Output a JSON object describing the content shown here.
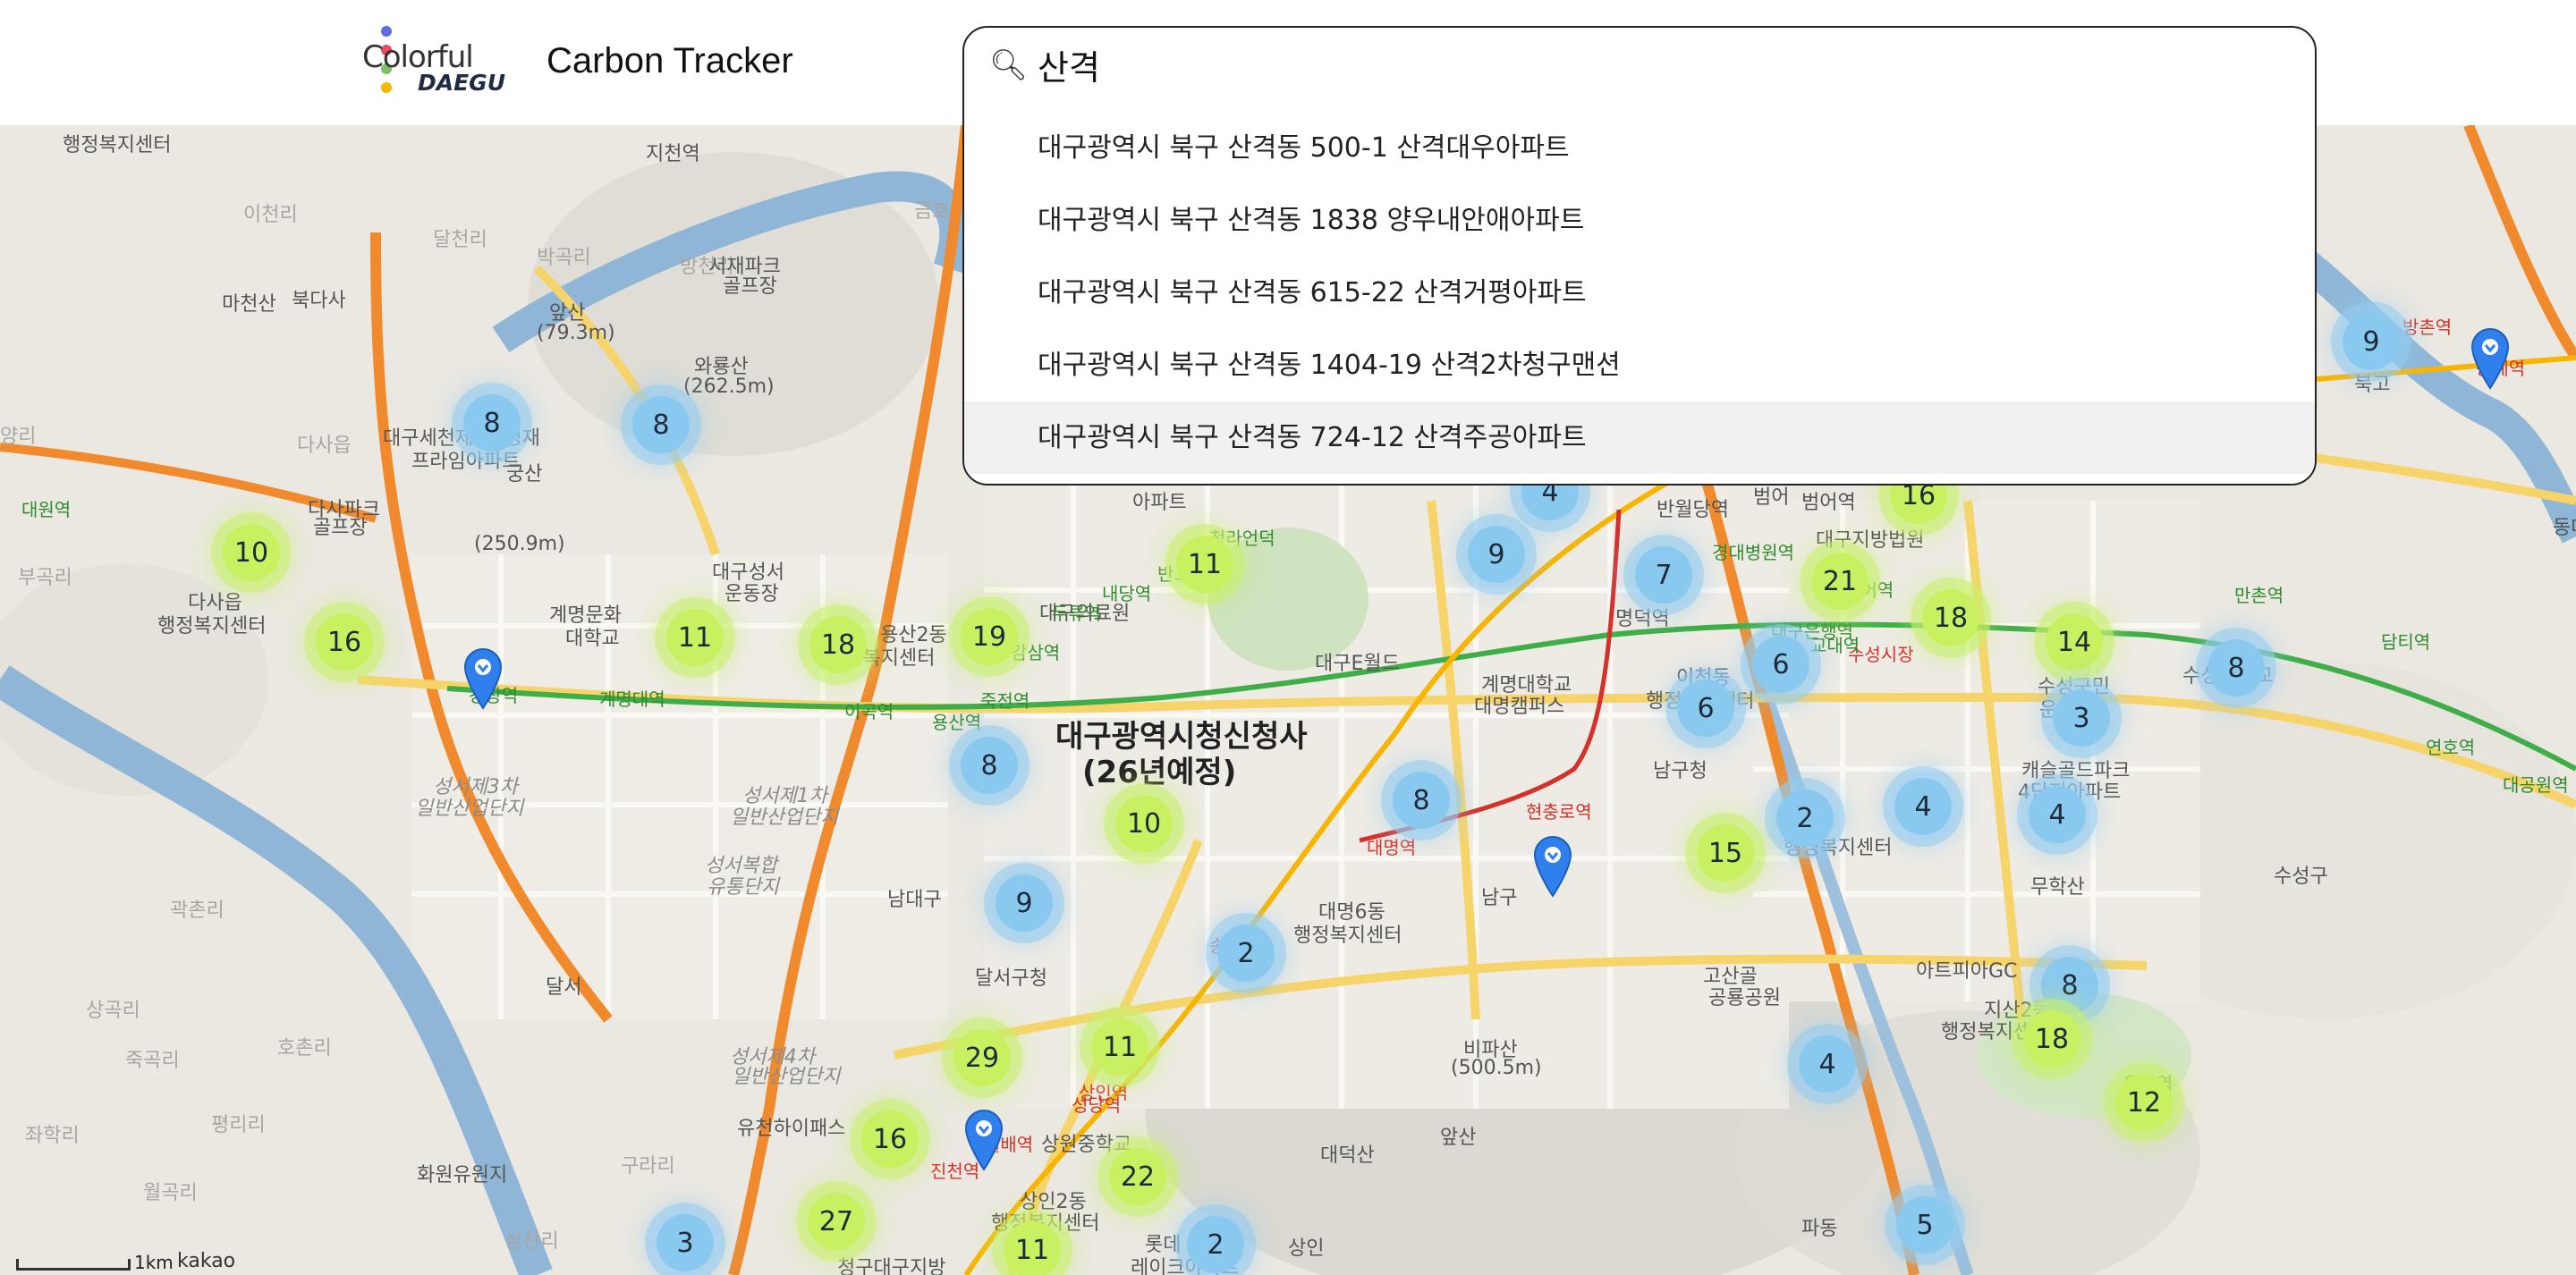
{
  "header": {
    "logo_line1": "Colorful",
    "logo_line2": "DAEGU",
    "title": "Carbon Tracker"
  },
  "search": {
    "query": "산격",
    "suggestions": [
      "대구광역시 북구 산격동 500-1 산격대우아파트",
      "대구광역시 북구 산격동 1838 양우내안애아파트",
      "대구광역시 북구 산격동 615-22 산격거평아파트",
      "대구광역시 북구 산격동 1404-19 산격2차청구맨션",
      "대구광역시 북구 산격동 724-12 산격주공아파트"
    ],
    "highlighted_index": 4
  },
  "map": {
    "attribution": "kakao",
    "scale_label": "1km",
    "labels": [
      {
        "text": "행정복지센터"
      },
      {
        "text": "지천역"
      },
      {
        "text": "금호"
      },
      {
        "text": "이천리"
      },
      {
        "text": "달천리"
      },
      {
        "text": "박곡리"
      },
      {
        "text": "방천리"
      },
      {
        "text": "마천산"
      },
      {
        "text": "북다사"
      },
      {
        "text": "앞산"
      },
      {
        "text": "(79.3m)"
      },
      {
        "text": "서재파크"
      },
      {
        "text": "골프장"
      },
      {
        "text": "와룡산"
      },
      {
        "text": "(262.5m)"
      },
      {
        "text": "다사읍"
      },
      {
        "text": "대구세천제1동경재"
      },
      {
        "text": "프라임아파트"
      },
      {
        "text": "다사파크"
      },
      {
        "text": "골프장"
      },
      {
        "text": "궁산"
      },
      {
        "text": "(250.9m)"
      },
      {
        "text": "부곡리"
      },
      {
        "text": "다사읍"
      },
      {
        "text": "행정복지센터"
      },
      {
        "text": "계명문화"
      },
      {
        "text": "대학교"
      },
      {
        "text": "대구성서"
      },
      {
        "text": "운동장"
      },
      {
        "text": "용산2동"
      },
      {
        "text": "행정복지센터"
      },
      {
        "text": "대구의료원"
      },
      {
        "text": "아파트"
      },
      {
        "text": "대구E월드"
      },
      {
        "text": "계명대학교"
      },
      {
        "text": "대명캠퍼스"
      },
      {
        "text": "대구광역시청신청사"
      },
      {
        "text": "(26년예정)"
      },
      {
        "text": "성서제3차"
      },
      {
        "text": "일반산업단지"
      },
      {
        "text": "성서제1차"
      },
      {
        "text": "일반산업단지"
      },
      {
        "text": "성서복합"
      },
      {
        "text": "유통단지"
      },
      {
        "text": "남대구"
      },
      {
        "text": "달서구청"
      },
      {
        "text": "대명6동"
      },
      {
        "text": "행정복지센터"
      },
      {
        "text": "남구"
      },
      {
        "text": "곽촌리"
      },
      {
        "text": "상곡리"
      },
      {
        "text": "호촌리"
      },
      {
        "text": "평리리"
      },
      {
        "text": "좌학리"
      },
      {
        "text": "구라리"
      },
      {
        "text": "화원유원지"
      },
      {
        "text": "유천하이패스"
      },
      {
        "text": "달서"
      },
      {
        "text": "성서제4차"
      },
      {
        "text": "일반산업단지"
      },
      {
        "text": "상원중학교"
      },
      {
        "text": "상인2동"
      },
      {
        "text": "행정복지센터"
      },
      {
        "text": "롯데"
      },
      {
        "text": "레이크아파트"
      },
      {
        "text": "상인"
      },
      {
        "text": "비파산"
      },
      {
        "text": "(500.5m)"
      },
      {
        "text": "대덕산"
      },
      {
        "text": "앞산"
      },
      {
        "text": "반월당역"
      },
      {
        "text": "명덕역"
      },
      {
        "text": "이천동"
      },
      {
        "text": "행정복지센터"
      },
      {
        "text": "남구청"
      },
      {
        "text": "범어역"
      },
      {
        "text": "대구지방법원"
      },
      {
        "text": "수성구민"
      },
      {
        "text": "운동장"
      },
      {
        "text": "중동"
      },
      {
        "text": "행정복지센터"
      },
      {
        "text": "캐슬골드파크"
      },
      {
        "text": "4단지아파트"
      },
      {
        "text": "무학산"
      },
      {
        "text": "수성대학교"
      },
      {
        "text": "수성구"
      },
      {
        "text": "고산골"
      },
      {
        "text": "공룡공원"
      },
      {
        "text": "아트피아GC"
      },
      {
        "text": "지산2동"
      },
      {
        "text": "행정복지센터"
      },
      {
        "text": "파동"
      },
      {
        "text": "청구대구지방"
      },
      {
        "text": "범어"
      },
      {
        "text": "동대"
      },
      {
        "text": "방촌역"
      },
      {
        "text": "용계역"
      },
      {
        "text": "북고"
      },
      {
        "text": "대공원역"
      },
      {
        "text": "연호역"
      },
      {
        "text": "담티역"
      },
      {
        "text": "만촌역"
      },
      {
        "text": "범어역"
      },
      {
        "text": "수성시장"
      },
      {
        "text": "대명역"
      },
      {
        "text": "현충로역"
      },
      {
        "text": "계명대역"
      },
      {
        "text": "이곡역"
      },
      {
        "text": "용산역"
      },
      {
        "text": "죽전역"
      },
      {
        "text": "감삼역"
      },
      {
        "text": "두류역"
      },
      {
        "text": "내당역"
      },
      {
        "text": "반고개역"
      },
      {
        "text": "청라언덕"
      },
      {
        "text": "경대병원역"
      },
      {
        "text": "대구은행역"
      },
      {
        "text": "교대역"
      },
      {
        "text": "송현역"
      },
      {
        "text": "성당역"
      },
      {
        "text": "진천역"
      },
      {
        "text": "월배역"
      },
      {
        "text": "상인역"
      },
      {
        "text": "용지역"
      },
      {
        "text": "월곡리"
      },
      {
        "text": "죽곡리"
      },
      {
        "text": "양리"
      },
      {
        "text": "성산리"
      },
      {
        "text": "대원역"
      },
      {
        "text": "강창역"
      }
    ],
    "clusters": [
      {
        "count": 8,
        "color": "blue"
      },
      {
        "count": 8,
        "color": "blue"
      },
      {
        "count": 10,
        "color": "green"
      },
      {
        "count": 16,
        "color": "green"
      },
      {
        "count": 11,
        "color": "green"
      },
      {
        "count": 18,
        "color": "green"
      },
      {
        "count": 19,
        "color": "green"
      },
      {
        "count": 11,
        "color": "green"
      },
      {
        "count": 8,
        "color": "blue"
      },
      {
        "count": 10,
        "color": "green"
      },
      {
        "count": 9,
        "color": "blue"
      },
      {
        "count": 2,
        "color": "blue"
      },
      {
        "count": 29,
        "color": "green"
      },
      {
        "count": 11,
        "color": "green"
      },
      {
        "count": 16,
        "color": "green"
      },
      {
        "count": 22,
        "color": "green"
      },
      {
        "count": 27,
        "color": "green"
      },
      {
        "count": 3,
        "color": "blue"
      },
      {
        "count": 11,
        "color": "green"
      },
      {
        "count": 2,
        "color": "blue"
      },
      {
        "count": 8,
        "color": "blue"
      },
      {
        "count": 4,
        "color": "blue"
      },
      {
        "count": 9,
        "color": "blue"
      },
      {
        "count": 7,
        "color": "blue"
      },
      {
        "count": 21,
        "color": "green"
      },
      {
        "count": 16,
        "color": "green"
      },
      {
        "count": 6,
        "color": "blue"
      },
      {
        "count": 6,
        "color": "blue"
      },
      {
        "count": 18,
        "color": "green"
      },
      {
        "count": 14,
        "color": "green"
      },
      {
        "count": 3,
        "color": "blue"
      },
      {
        "count": 8,
        "color": "blue"
      },
      {
        "count": 4,
        "color": "blue"
      },
      {
        "count": 2,
        "color": "blue"
      },
      {
        "count": 15,
        "color": "green"
      },
      {
        "count": 4,
        "color": "blue"
      },
      {
        "count": 8,
        "color": "blue"
      },
      {
        "count": 18,
        "color": "green"
      },
      {
        "count": 12,
        "color": "green"
      },
      {
        "count": 4,
        "color": "blue"
      },
      {
        "count": 5,
        "color": "blue"
      },
      {
        "count": 9,
        "color": "blue"
      }
    ],
    "pins": [
      {
        "name": "pin"
      },
      {
        "name": "pin"
      },
      {
        "name": "pin"
      },
      {
        "name": "pin"
      }
    ],
    "colors": {
      "cluster_blue": "#8ac9ef",
      "cluster_green": "#c8f060",
      "pin_blue": "#2f80ed",
      "road": "#f7c948",
      "highway": "#f08a2c",
      "river": "#8fb6d6"
    }
  }
}
